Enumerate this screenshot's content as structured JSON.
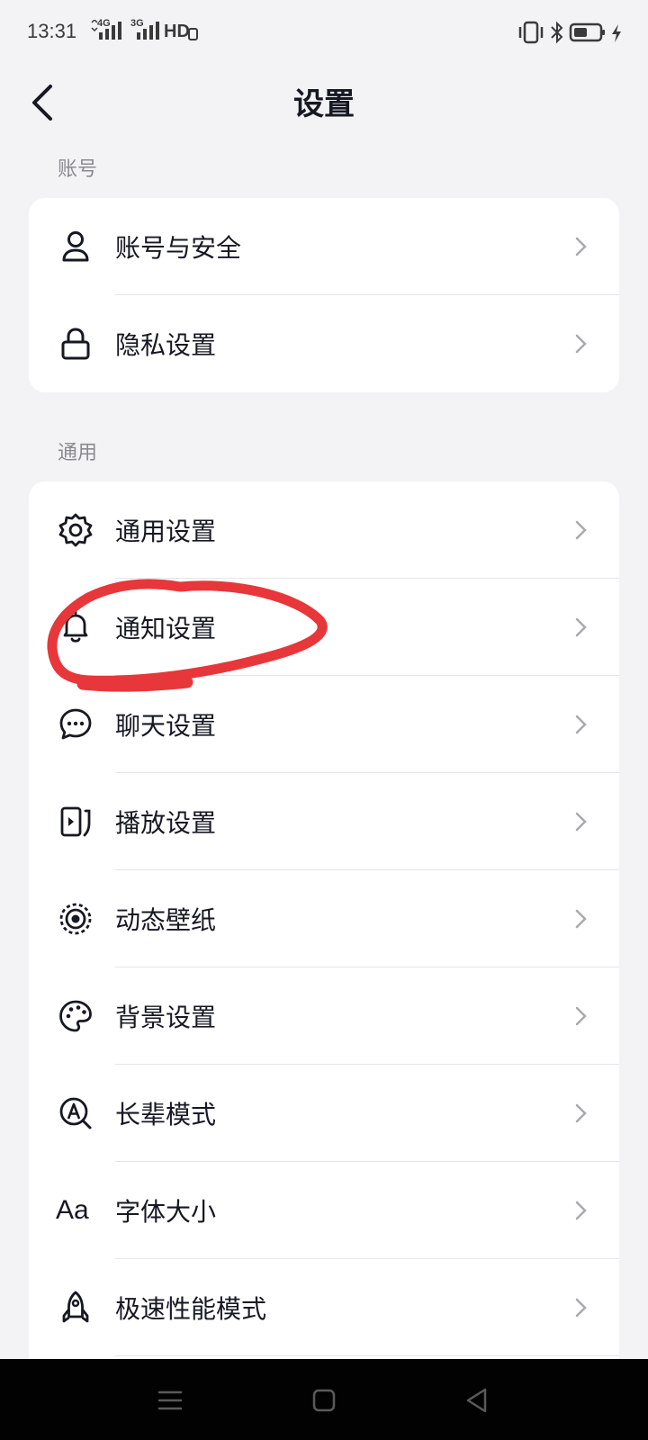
{
  "status_bar": {
    "time": "13:31",
    "signal1_label": "4G",
    "signal2_label": "3G",
    "hd_label": "HD",
    "battery_icon": "battery-icon",
    "bluetooth_icon": "bluetooth-icon",
    "vibrate_icon": "vibrate-icon",
    "charging_icon": "charging-icon"
  },
  "header": {
    "title": "设置",
    "back_icon": "chevron-left-icon"
  },
  "sections": [
    {
      "label": "账号",
      "items": [
        {
          "label": "账号与安全",
          "icon": "user-icon"
        },
        {
          "label": "隐私设置",
          "icon": "lock-icon"
        }
      ]
    },
    {
      "label": "通用",
      "items": [
        {
          "label": "通用设置",
          "icon": "gear-icon"
        },
        {
          "label": "通知设置",
          "icon": "bell-icon"
        },
        {
          "label": "聊天设置",
          "icon": "chat-bubble-icon"
        },
        {
          "label": "播放设置",
          "icon": "play-screen-icon"
        },
        {
          "label": "动态壁纸",
          "icon": "live-wallpaper-icon"
        },
        {
          "label": "背景设置",
          "icon": "palette-icon"
        },
        {
          "label": "长辈模式",
          "icon": "elder-mode-icon"
        },
        {
          "label": "字体大小",
          "icon": "font-size-icon",
          "icon_text": "Aa"
        },
        {
          "label": "极速性能模式",
          "icon": "rocket-icon"
        }
      ]
    }
  ],
  "annotation": {
    "color": "#e8373a",
    "shape": "hand-drawn-circle",
    "target": "通知设置"
  },
  "nav_bar": {
    "menu_icon": "menu-icon",
    "home_icon": "home-square-icon",
    "back_icon": "back-triangle-icon"
  },
  "colors": {
    "background": "#f3f3f5",
    "card": "#ffffff",
    "text": "#161823",
    "secondary": "#8a8b91",
    "chevron": "#a9aaaf",
    "navbar": "#020202"
  }
}
